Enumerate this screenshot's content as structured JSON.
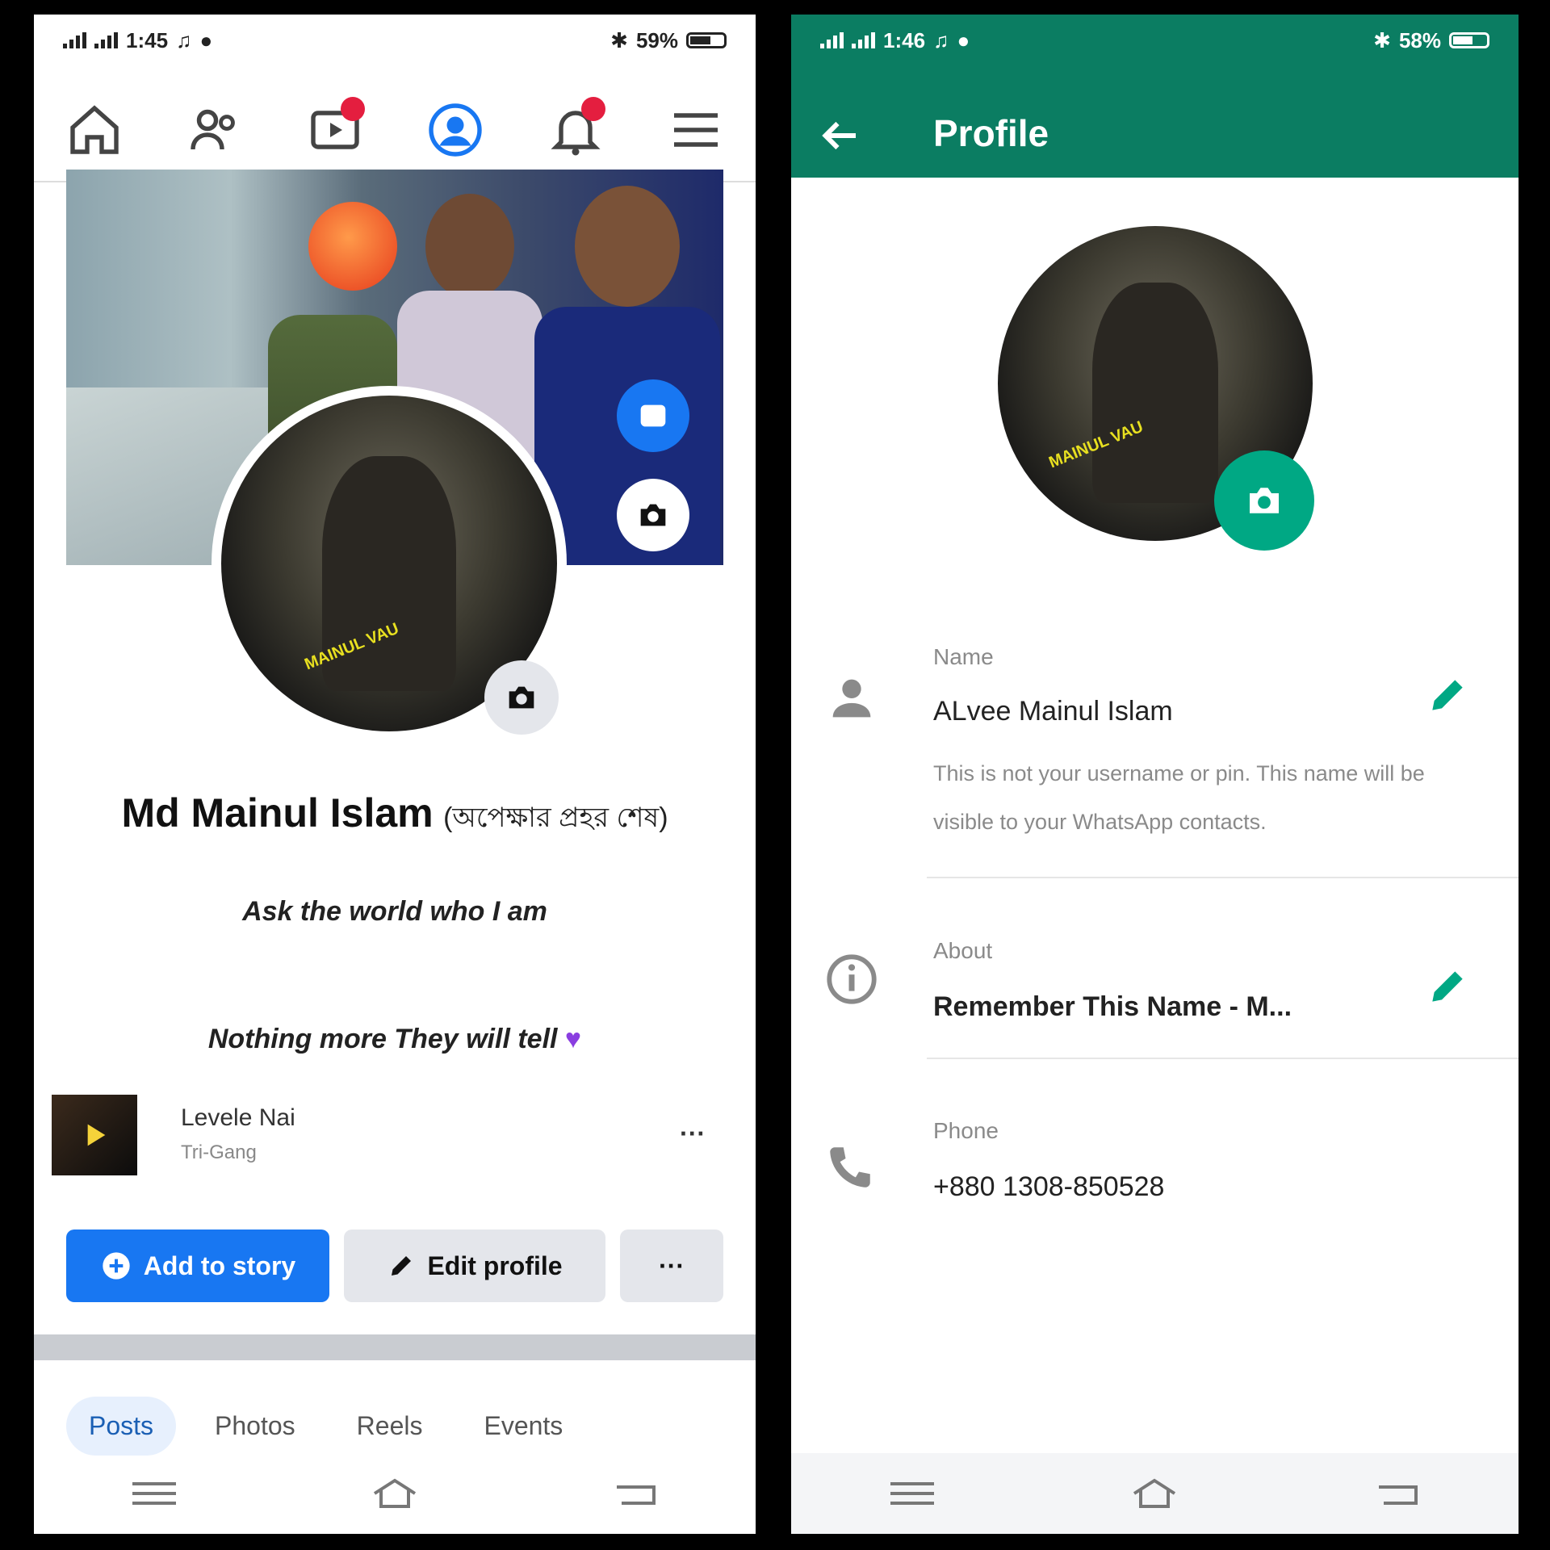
{
  "facebook": {
    "status": {
      "time": "1:45",
      "battery": "59%"
    },
    "name": "Md Mainul Islam",
    "name_suffix": "(অপেক্ষার প্রহর শেষ)",
    "bio_line1": "Ask the world who I am ",
    "bio_line2": "Nothing more They will tell",
    "song": {
      "title": "Levele Nai",
      "artist": "Tri-Gang"
    },
    "buttons": {
      "add_story": "Add to story",
      "edit_profile": "Edit profile",
      "more": "···"
    },
    "tabs": [
      "Posts",
      "Photos",
      "Reels",
      "Events"
    ],
    "colors": {
      "accent": "#1877f2",
      "badge": "#e41e3f"
    }
  },
  "whatsapp": {
    "status": {
      "time": "1:46",
      "battery": "58%"
    },
    "title": "Profile",
    "name_label": "Name",
    "name_value": "ALvee Mainul Islam",
    "name_note": "This is not your username or pin. This name will be visible to your WhatsApp contacts.",
    "about_label": "About",
    "about_value": "Remember This Name - M...",
    "phone_label": "Phone",
    "phone_value": "+880 1308-850528",
    "colors": {
      "header": "#0b7d62",
      "camera": "#00a884"
    }
  }
}
